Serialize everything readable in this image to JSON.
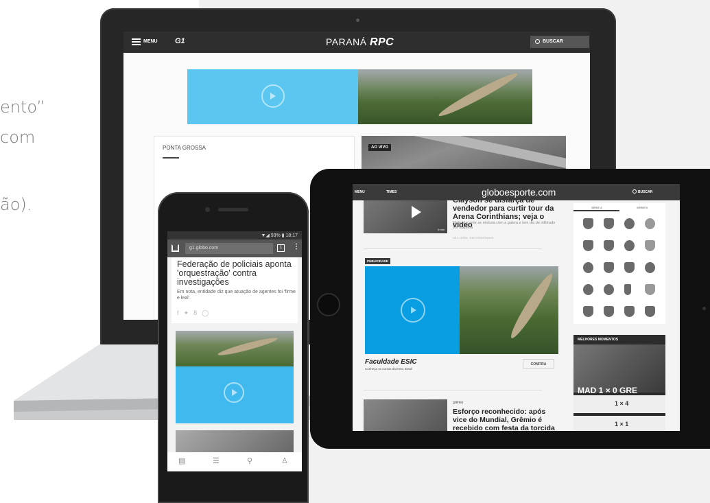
{
  "left_text": {
    "line1": "ento”",
    "line2": "com",
    "line3": "ão)."
  },
  "laptop": {
    "nav": {
      "menu_label": "MENU",
      "g1_logo": "G1",
      "brand_region": "PARANÁ",
      "brand_name": "RPC",
      "search_label": "BUSCAR"
    },
    "section_title": "PONTA GROSSA",
    "live_badge": "AO VIVO"
  },
  "tablet": {
    "nav": {
      "menu_label": "MENU",
      "times_label": "TIMES",
      "brand": "globoesporte.com",
      "search_label": "BUSCAR"
    },
    "story1": {
      "title": "Clayson se disfarça de vendedor para curtir tour da Arena Corinthians; veja o vídeo",
      "subtitle": "Meia-atacante se mistura com a galera e tem dia de infiltrado em Itaquera",
      "meta": "HÁ 1 HORA · EM CORINTHIANS",
      "duration": "6 min"
    },
    "publicidade": "PUBLICIDADE",
    "ad": {
      "brand": "Faculdade ESIC",
      "subtitle": "Conheça os cursos da ESIC Brasil",
      "cta": "CONFIRA"
    },
    "story2": {
      "tag": "grêmio",
      "title": "Esforço reconhecido: após vice do Mundial, Grêmio é recebido com festa da torcida"
    },
    "sidebar": {
      "tab_a": "SÉRIE A",
      "tab_b": "SÉRIE B",
      "melhores_title": "MELHORES MOMENTOS",
      "main_score": "MAD 1 × 0 GRE",
      "row1_score": "1 × 4",
      "row2_score": "1 × 1"
    }
  },
  "phone": {
    "status": "▼◢ 99% ▮ 18:17",
    "url": "g1.globo.com",
    "tabs_count": "1",
    "article": {
      "title": "Federação de policiais aponta 'orquestração' contra investigações",
      "body": "Em nota, entidade diz que atuação de agentes foi 'firme e leal'."
    }
  }
}
